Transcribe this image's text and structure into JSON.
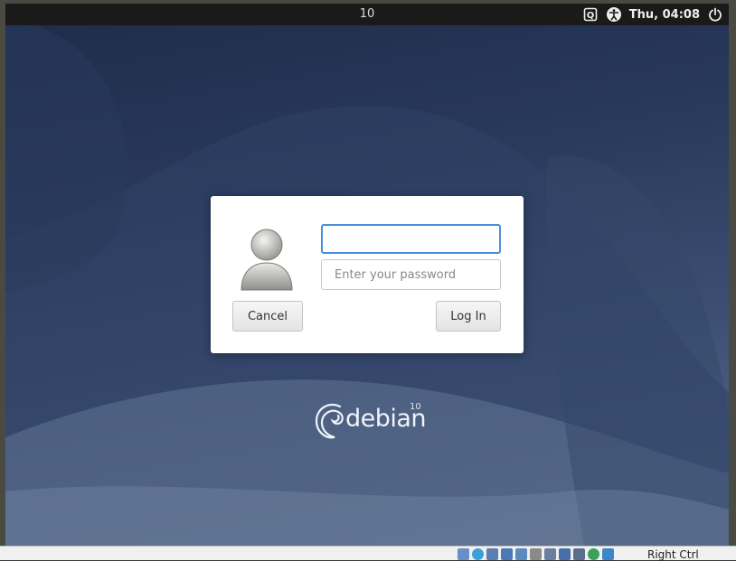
{
  "topbar": {
    "workspace_label": "10",
    "clock": "Thu, 04:08",
    "icons": [
      "input-method-icon",
      "accessibility-icon",
      "power-icon"
    ]
  },
  "login": {
    "username_value": "",
    "password_placeholder": "Enter your password",
    "cancel_label": "Cancel",
    "login_label": "Log In",
    "avatar_icon": "user-avatar-icon",
    "focus_color": "#4a90d9"
  },
  "branding": {
    "logo_word": "debian",
    "version": "10"
  },
  "host_statusbar": {
    "host_key_label": "Right Ctrl",
    "icons": [
      "hdd-icon",
      "optical-drive-icon",
      "audio-icon",
      "network-icon",
      "usb-icon",
      "shared-folder-icon",
      "display-icon",
      "recording-icon",
      "cpu-icon",
      "mouse-integration-icon",
      "keyboard-icon"
    ]
  },
  "colors": {
    "topbar_bg": "#1a1a1a",
    "card_bg": "#ffffff",
    "wallpaper_dark": "#1e2c4a",
    "wallpaper_light": "#5a6f90"
  }
}
